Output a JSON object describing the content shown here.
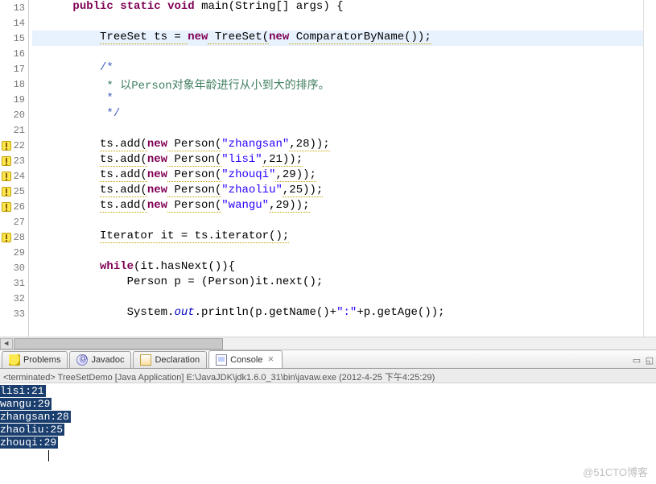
{
  "gutter": {
    "start": 13,
    "end": 33,
    "warnings": [
      22,
      23,
      24,
      25,
      26,
      28
    ]
  },
  "code": {
    "l13": {
      "pre": "      ",
      "kw1": "public",
      "sp1": " ",
      "kw2": "static",
      "sp2": " ",
      "kw3": "void",
      "sp3": " ",
      "fn": "main(String[] args) {"
    },
    "l15": {
      "pre": "          ",
      "t1": "TreeSet ts = ",
      "kw1": "new",
      "t2": " TreeSet(",
      "kw2": "new",
      "t3": " ComparatorByName());"
    },
    "l17": {
      "pre": "          ",
      "c": "/*"
    },
    "l18": {
      "pre": "           ",
      "c": "* 以Person对象年龄进行从小到大的排序。"
    },
    "l19": {
      "pre": "           ",
      "c": "*"
    },
    "l20": {
      "pre": "           ",
      "c": "*/"
    },
    "l22": {
      "pre": "          ",
      "t1": "ts.add(",
      "kw": "new",
      "t2": " Person(",
      "s": "\"zhangsan\"",
      "t3": ",28));"
    },
    "l23": {
      "pre": "          ",
      "t1": "ts.add(",
      "kw": "new",
      "t2": " Person(",
      "s": "\"lisi\"",
      "t3": ",21));"
    },
    "l24": {
      "pre": "          ",
      "t1": "ts.add(",
      "kw": "new",
      "t2": " Person(",
      "s": "\"zhouqi\"",
      "t3": ",29));"
    },
    "l25": {
      "pre": "          ",
      "t1": "ts.add(",
      "kw": "new",
      "t2": " Person(",
      "s": "\"zhaoliu\"",
      "t3": ",25));"
    },
    "l26": {
      "pre": "          ",
      "t1": "ts.add(",
      "kw": "new",
      "t2": " Person(",
      "s": "\"wangu\"",
      "t3": ",29));"
    },
    "l28": {
      "pre": "          ",
      "t1": "Iterator it = ts.iterator();"
    },
    "l30": {
      "pre": "          ",
      "kw": "while",
      "t1": "(it.hasNext()){"
    },
    "l31": {
      "pre": "              ",
      "t1": "Person p = (Person)it.next();"
    },
    "l33": {
      "pre": "              ",
      "t1": "System.",
      "f": "out",
      "t2": ".println(p.getName()+",
      "s": "\":\"",
      "t3": "+p.getAge());"
    }
  },
  "tabs": {
    "problems": "Problems",
    "javadoc": "Javadoc",
    "declaration": "Declaration",
    "console": "Console"
  },
  "console": {
    "header": "<terminated> TreeSetDemo [Java Application] E:\\JavaJDK\\jdk1.6.0_31\\bin\\javaw.exe (2012-4-25 下午4:25:29)",
    "lines": [
      "lisi:21",
      "wangu:29",
      "zhangsan:28",
      "zhaoliu:25",
      "zhouqi:29"
    ]
  },
  "watermark": "@51CTO博客"
}
